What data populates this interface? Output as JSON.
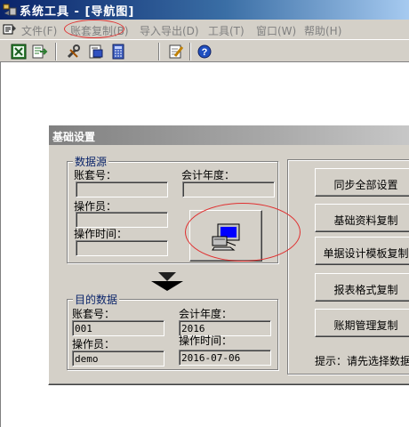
{
  "window": {
    "title": "系统工具 - [导航图]"
  },
  "menu": {
    "items": [
      {
        "label": "文件(F)"
      },
      {
        "label": "账套复制(B)"
      },
      {
        "label": "导入导出(D)"
      },
      {
        "label": "工具(T)"
      },
      {
        "label": "窗口(W)"
      },
      {
        "label": "帮助(H)"
      }
    ]
  },
  "toolbar": {
    "icons": [
      "excel-icon",
      "export-icon",
      "tools-icon",
      "print-preview-icon",
      "calculator-icon",
      "edit-icon",
      "help-icon"
    ]
  },
  "dialog": {
    "title": "基础设置",
    "source": {
      "legend": "数据源",
      "account_label": "账套号：",
      "account_value": "",
      "year_label": "会计年度：",
      "year_value": "",
      "operator_label": "操作员：",
      "operator_value": "",
      "optime_label": "操作时间：",
      "optime_value": ""
    },
    "target": {
      "legend": "目的数据",
      "account_label": "账套号：",
      "account_value": "001",
      "year_label": "会计年度：",
      "year_value": "2016",
      "operator_label": "操作员：",
      "operator_value": "demo",
      "optime_label": "操作时间：",
      "optime_value": "2016-07-06"
    },
    "actions": [
      {
        "label": "同步全部设置"
      },
      {
        "label": "基础资料复制"
      },
      {
        "label": "单据设计模板复制"
      },
      {
        "label": "报表格式复制"
      },
      {
        "label": "账期管理复制"
      }
    ],
    "hint": "提示：请先选择数据"
  },
  "colors": {
    "annotation": "#e03030",
    "group_title": "#0a246a"
  }
}
